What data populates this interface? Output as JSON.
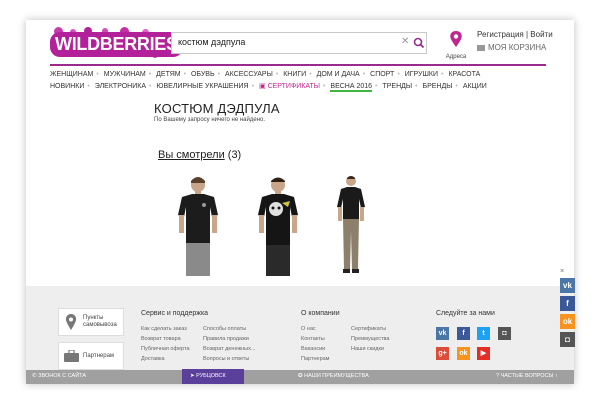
{
  "header": {
    "logo_text": "WILDBERRIES",
    "search_value": "костюм дэдпула",
    "address_label": "Адреса",
    "auth_text": "Регистрация | Войти",
    "cart_text": "МОЯ КОРЗИНА"
  },
  "nav": {
    "row1": [
      "ЖЕНЩИНАМ",
      "МУЖЧИНАМ",
      "ДЕТЯМ",
      "ОБУВЬ",
      "АКСЕССУАРЫ",
      "КНИГИ",
      "ДОМ И ДАЧА",
      "СПОРТ",
      "ИГРУШКИ",
      "КРАСОТА"
    ],
    "row2": [
      "НОВИНКИ",
      "ЭЛЕКТРОНИКА",
      "ЮВЕЛИРНЫЕ УКРАШЕНИЯ",
      "СЕРТИФИКАТЫ",
      "ВЕСНА 2016",
      "ТРЕНДЫ",
      "БРЕНДЫ",
      "АКЦИИ"
    ]
  },
  "main": {
    "title": "КОСТЮМ ДЭДПУЛА",
    "not_found": "По Вашему запросу ничего не найдено.",
    "viewed_link": "Вы смотрели",
    "viewed_count": "(3)"
  },
  "footer": {
    "pickup": "Пункты самовывоза",
    "partners": "Партнерам",
    "service_title": "Сервис и поддержка",
    "service_col1": [
      "Как сделать заказ",
      "Возврат товара",
      "Публичная оферта",
      "Доставка"
    ],
    "service_col2": [
      "Способы оплаты",
      "Правила продажи",
      "Возврат денежных...",
      "Вопросы и ответы"
    ],
    "company_title": "О компании",
    "company_col1": [
      "О нас",
      "Контакты",
      "Вакансии",
      "Партнерам"
    ],
    "company_col2": [
      "Сертификаты",
      "Преимущества",
      "Наши скидки"
    ],
    "follow_title": "Следуйте за нами",
    "bottom": {
      "call": "ЗВОНОК С САЙТА",
      "ruble": "РУБЦОВСК",
      "advantages": "НАШИ ПРЕИМУЩЕСТВА",
      "faq": "ЧАСТЫЕ ВОПРОСЫ"
    }
  },
  "colors": {
    "brand": "#b3219a",
    "nav_line": "#9b2a8e",
    "vk": "#4a76a8",
    "facebook": "#3b5998",
    "twitter": "#1da1f2",
    "instagram": "#555555",
    "googleplus": "#dd4b39",
    "ok": "#f7931e",
    "youtube": "#e52d27"
  }
}
